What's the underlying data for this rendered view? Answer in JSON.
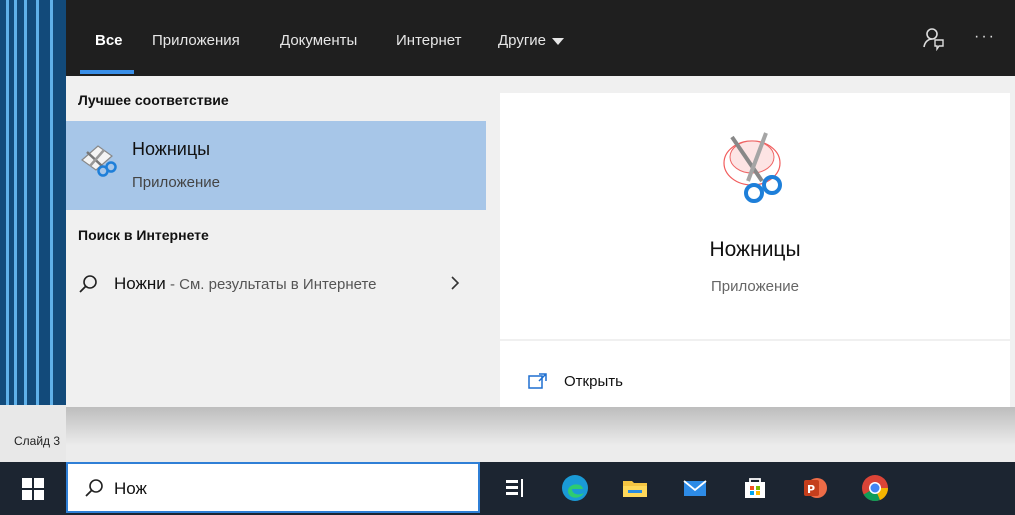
{
  "tabs": [
    {
      "label": "Все"
    },
    {
      "label": "Приложения"
    },
    {
      "label": "Документы"
    },
    {
      "label": "Интернет"
    },
    {
      "label": "Другие"
    }
  ],
  "best_match": {
    "heading": "Лучшее соответствие",
    "title": "Ножницы",
    "subtitle": "Приложение"
  },
  "web_search": {
    "heading": "Поиск в Интернете",
    "query": "Ножни",
    "hint": " - См. результаты в Интернете"
  },
  "preview": {
    "title": "Ножницы",
    "subtitle": "Приложение",
    "open_label": "Открыть"
  },
  "background": {
    "slide_label": "Слайд 3"
  },
  "searchbox": {
    "value": "Нож"
  },
  "icons": {
    "feedback": "feedback-icon",
    "more": "more-options-icon",
    "app": "snipping-tool-icon",
    "search": "search-icon",
    "chevron": "chevron-right-icon",
    "open": "open-icon",
    "start": "windows-start-icon",
    "taskview": "task-view-icon",
    "edge": "edge-icon",
    "explorer": "file-explorer-icon",
    "mail": "mail-icon",
    "store": "store-icon",
    "powerpoint": "powerpoint-icon",
    "chrome": "chrome-icon"
  },
  "colors": {
    "accent": "#3a8fe8",
    "selection": "#a7c6e8",
    "topbar": "#1f1f1f",
    "taskbar": "#1c2531"
  }
}
